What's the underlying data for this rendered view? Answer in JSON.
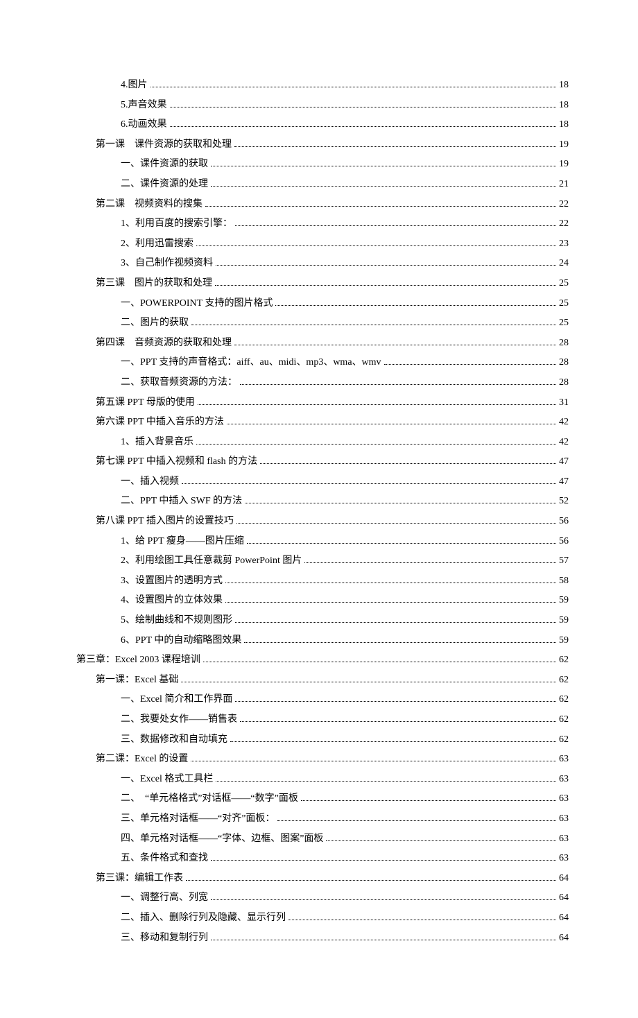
{
  "toc": [
    {
      "indent": 2,
      "text": "4.图片",
      "page": "18"
    },
    {
      "indent": 2,
      "text": "5.声音效果",
      "page": "18"
    },
    {
      "indent": 2,
      "text": "6.动画效果",
      "page": "18"
    },
    {
      "indent": 1,
      "text": "第一课　课件资源的获取和处理",
      "page": "19"
    },
    {
      "indent": 2,
      "text": "一、课件资源的获取",
      "page": "19"
    },
    {
      "indent": 2,
      "text": "二、课件资源的处理",
      "page": "21"
    },
    {
      "indent": 1,
      "text": "第二课　视频资料的搜集",
      "page": "22"
    },
    {
      "indent": 2,
      "text": "1、利用百度的搜索引擎：",
      "page": "22"
    },
    {
      "indent": 2,
      "text": "2、利用迅雷搜索",
      "page": "23"
    },
    {
      "indent": 2,
      "text": "3、自己制作视频资料",
      "page": "24"
    },
    {
      "indent": 1,
      "text": "第三课　图片的获取和处理",
      "page": "25"
    },
    {
      "indent": 2,
      "text": "一、POWERPOINT 支持的图片格式",
      "page": "25"
    },
    {
      "indent": 2,
      "text": "二、图片的获取",
      "page": "25"
    },
    {
      "indent": 1,
      "text": "第四课　音频资源的获取和处理",
      "page": "28"
    },
    {
      "indent": 2,
      "text": "一、PPT 支持的声音格式：aiff、au、midi、mp3、wma、wmv",
      "page": "28"
    },
    {
      "indent": 2,
      "text": "二、获取音频资源的方法：",
      "page": "28"
    },
    {
      "indent": 1,
      "text": "第五课 PPT 母版的使用",
      "page": "31"
    },
    {
      "indent": 1,
      "text": "第六课 PPT 中插入音乐的方法",
      "page": "42"
    },
    {
      "indent": 2,
      "text": "1、插入背景音乐",
      "page": "42"
    },
    {
      "indent": 1,
      "text": "第七课 PPT 中插入视频和 flash 的方法",
      "page": "47"
    },
    {
      "indent": 2,
      "text": "一、插入视频",
      "page": "47"
    },
    {
      "indent": 2,
      "text": "二、PPT 中插入 SWF 的方法",
      "page": "52"
    },
    {
      "indent": 1,
      "text": "第八课 PPT 插入图片的设置技巧",
      "page": "56"
    },
    {
      "indent": 2,
      "text": "1、给 PPT 瘦身——图片压缩",
      "page": "56"
    },
    {
      "indent": 2,
      "text": "2、利用绘图工具任意裁剪 PowerPoint 图片",
      "page": "57"
    },
    {
      "indent": 2,
      "text": "3、设置图片的透明方式",
      "page": "58"
    },
    {
      "indent": 2,
      "text": "4、设置图片的立体效果",
      "page": "59"
    },
    {
      "indent": 2,
      "text": "5、绘制曲线和不规则图形",
      "page": "59"
    },
    {
      "indent": 2,
      "text": "6、PPT 中的自动缩略图效果",
      "page": "59"
    },
    {
      "indent": 0,
      "text": "第三章：Excel 2003 课程培训",
      "page": "62"
    },
    {
      "indent": 1,
      "text": "第一课：Excel 基础",
      "page": "62"
    },
    {
      "indent": 2,
      "text": "一、Excel 简介和工作界面",
      "page": "62"
    },
    {
      "indent": 2,
      "text": "二、我要处女作——销售表",
      "page": "62"
    },
    {
      "indent": 2,
      "text": "三、数据修改和自动填充",
      "page": "62"
    },
    {
      "indent": 1,
      "text": "第二课：Excel 的设置",
      "page": "63"
    },
    {
      "indent": 2,
      "text": "一、Excel 格式工具栏",
      "page": "63"
    },
    {
      "indent": 2,
      "text": "二、　“单元格格式”对话框——“数字”面板",
      "page": "63"
    },
    {
      "indent": 2,
      "text": "三、单元格对话框——“对齐”面板：",
      "page": "63"
    },
    {
      "indent": 2,
      "text": "四、单元格对话框——“字体、边框、图案”面板",
      "page": "63"
    },
    {
      "indent": 2,
      "text": "五、条件格式和查找",
      "page": "63"
    },
    {
      "indent": 1,
      "text": "第三课：编辑工作表",
      "page": "64"
    },
    {
      "indent": 2,
      "text": "一、调整行高、列宽",
      "page": "64"
    },
    {
      "indent": 2,
      "text": "二、插入、删除行列及隐藏、显示行列",
      "page": "64"
    },
    {
      "indent": 2,
      "text": "三、移动和复制行列",
      "page": "64"
    }
  ]
}
